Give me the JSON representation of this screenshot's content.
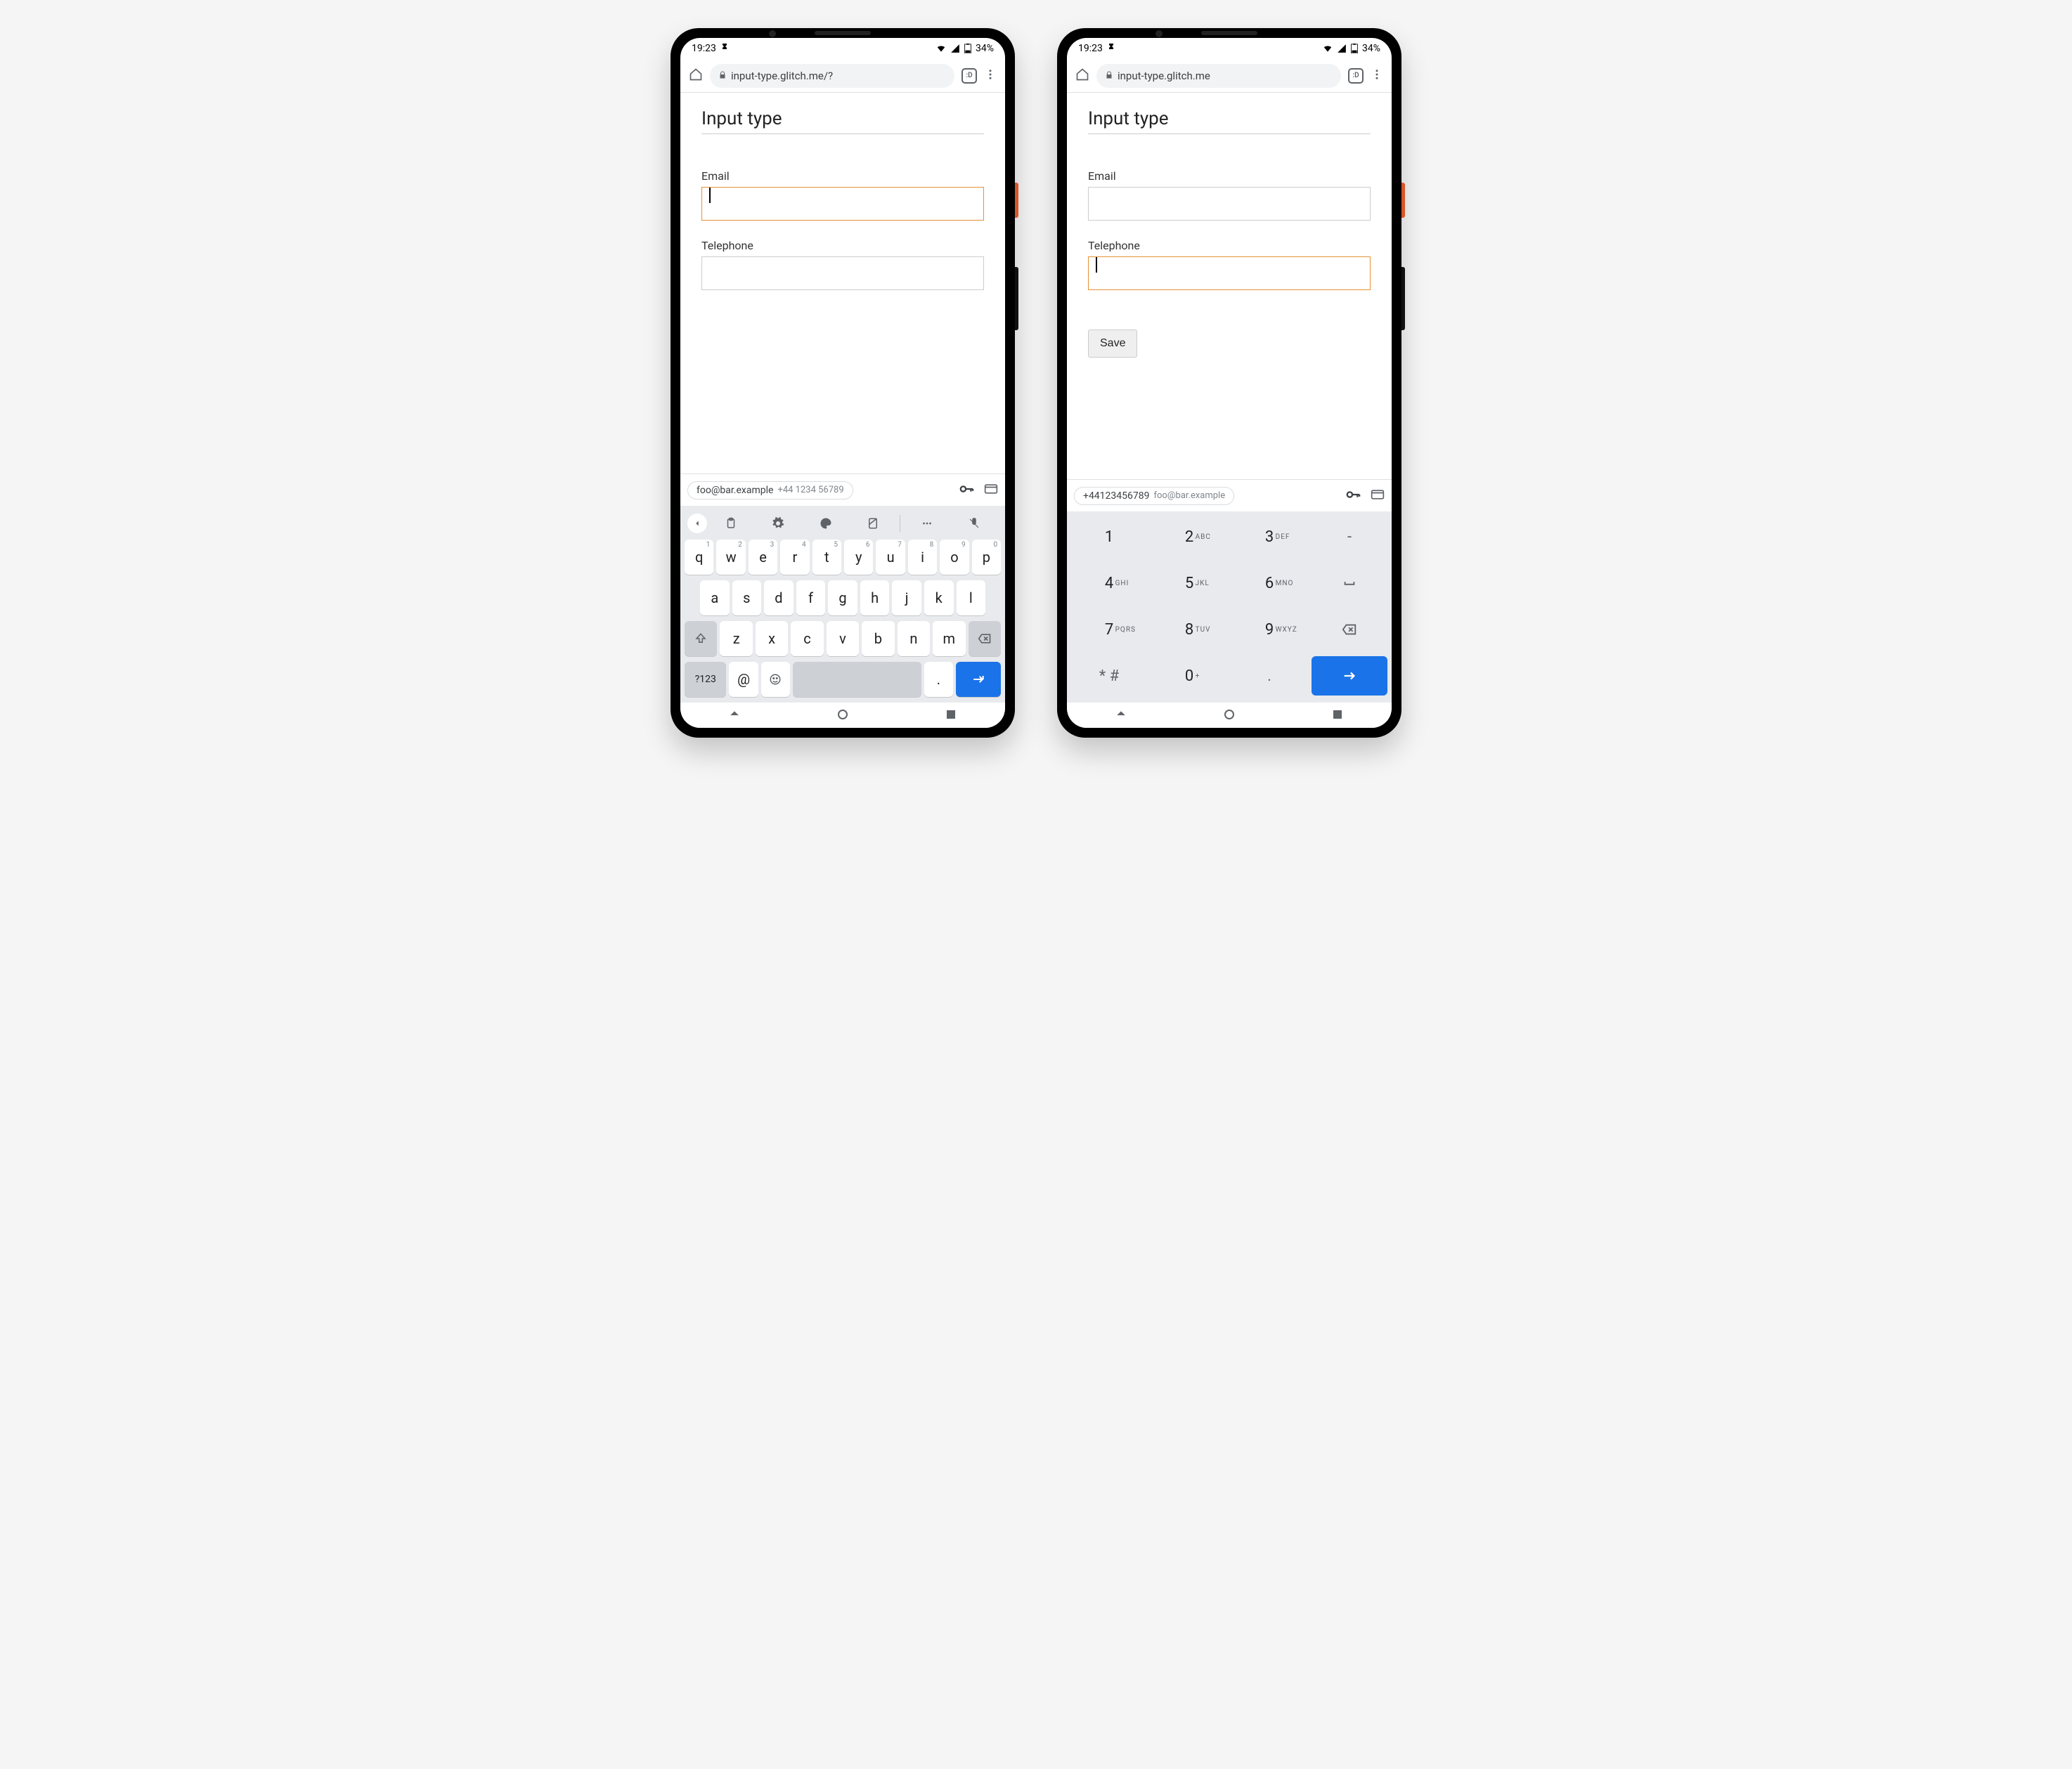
{
  "status": {
    "time": "19:23",
    "battery": "34%"
  },
  "phones": {
    "left": {
      "url": "input-type.glitch.me/?",
      "tab_count": ":D",
      "page_title": "Input type",
      "fields": {
        "email": "Email",
        "tel": "Telephone"
      },
      "focused_field": "email",
      "autofill": {
        "primary": "foo@bar.example",
        "secondary": "+44 1234 56789"
      },
      "qwerty": {
        "row1": [
          {
            "k": "q",
            "n": "1"
          },
          {
            "k": "w",
            "n": "2"
          },
          {
            "k": "e",
            "n": "3"
          },
          {
            "k": "r",
            "n": "4"
          },
          {
            "k": "t",
            "n": "5"
          },
          {
            "k": "y",
            "n": "6"
          },
          {
            "k": "u",
            "n": "7"
          },
          {
            "k": "i",
            "n": "8"
          },
          {
            "k": "o",
            "n": "9"
          },
          {
            "k": "p",
            "n": "0"
          }
        ],
        "row2": [
          "a",
          "s",
          "d",
          "f",
          "g",
          "h",
          "j",
          "k",
          "l"
        ],
        "row3": [
          "z",
          "x",
          "c",
          "v",
          "b",
          "n",
          "m"
        ],
        "row4": {
          "mode": "?123",
          "at": "@",
          "period": "."
        }
      }
    },
    "right": {
      "url": "input-type.glitch.me",
      "tab_count": ":D",
      "page_title": "Input type",
      "fields": {
        "email": "Email",
        "tel": "Telephone"
      },
      "focused_field": "tel",
      "save_label": "Save",
      "autofill": {
        "primary": "+44123456789",
        "secondary": "foo@bar.example"
      },
      "numpad": [
        [
          {
            "d": "1"
          },
          {
            "d": "2",
            "l": "ABC"
          },
          {
            "d": "3",
            "l": "DEF"
          },
          {
            "d": "-",
            "op": true
          }
        ],
        [
          {
            "d": "4",
            "l": "GHI"
          },
          {
            "d": "5",
            "l": "JKL"
          },
          {
            "d": "6",
            "l": "MNO"
          },
          {
            "d": "␣",
            "op": true
          }
        ],
        [
          {
            "d": "7",
            "l": "PQRS"
          },
          {
            "d": "8",
            "l": "TUV"
          },
          {
            "d": "9",
            "l": "WXYZ"
          },
          {
            "d": "⌫",
            "op": true
          }
        ],
        [
          {
            "d": "* #",
            "op": true
          },
          {
            "d": "0",
            "l": "+"
          },
          {
            "d": ".",
            "op": true
          },
          {
            "d": "→",
            "enter": true
          }
        ]
      ]
    }
  }
}
